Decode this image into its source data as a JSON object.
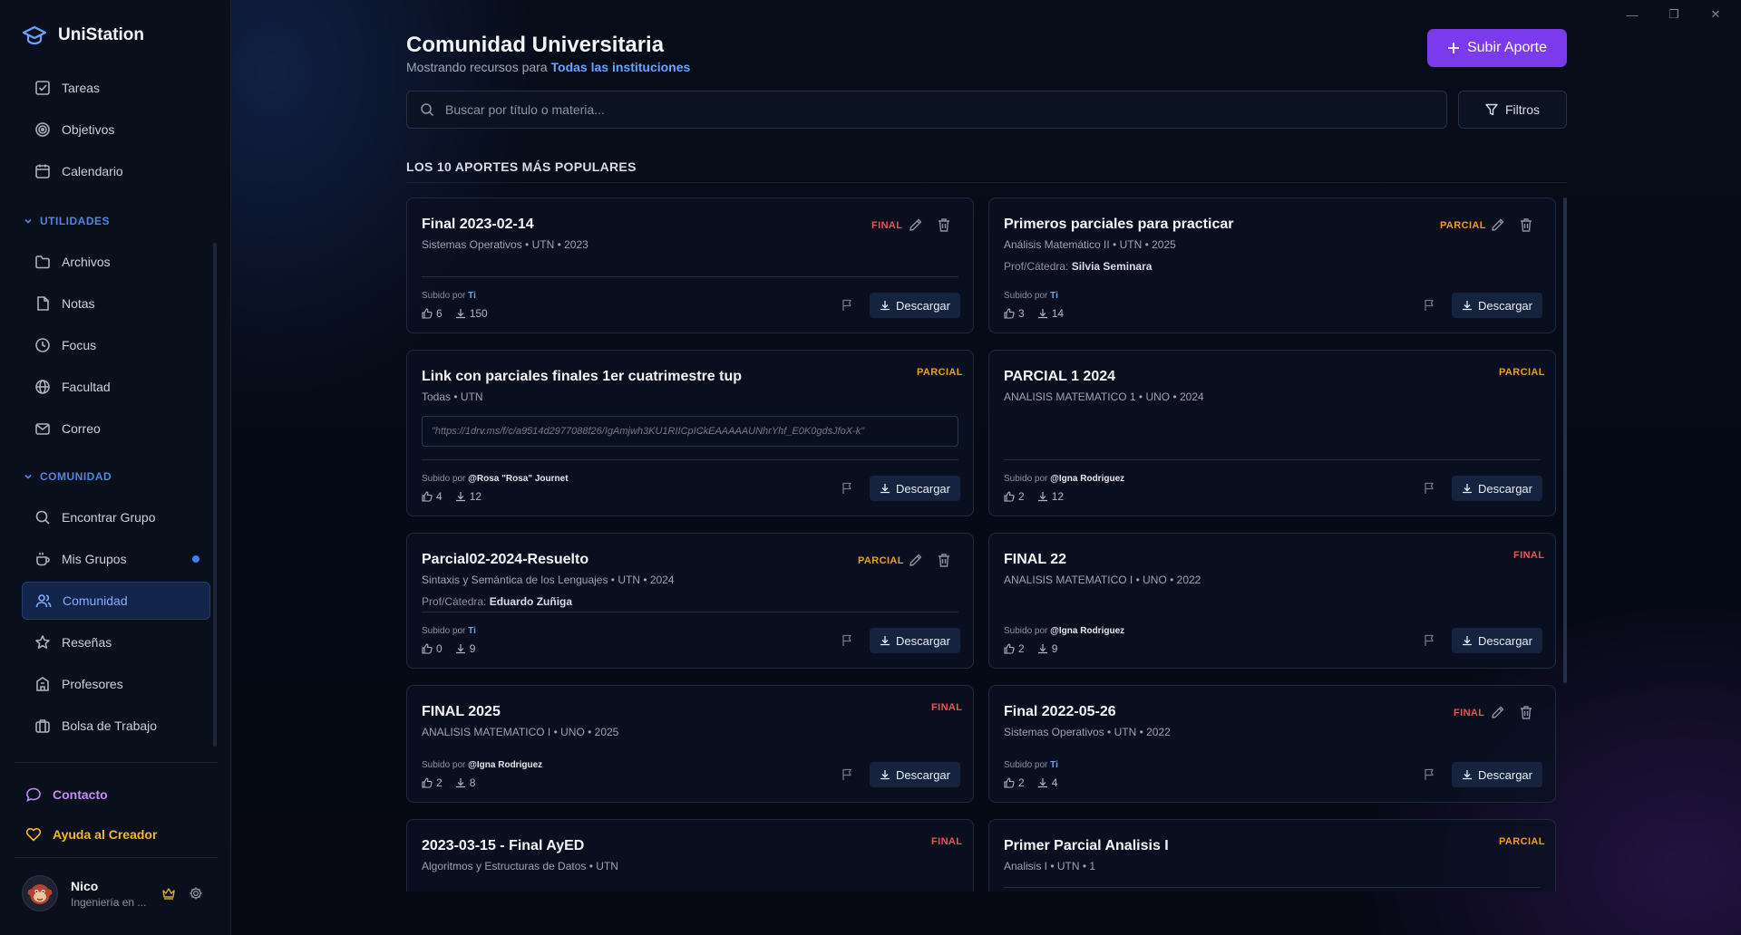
{
  "app": {
    "name": "UniStation"
  },
  "window": {
    "minimize": "—",
    "maximize": "❐",
    "close": "✕"
  },
  "sidebar": {
    "top_items": [
      {
        "label": "Tareas",
        "icon": "checkbox-icon"
      },
      {
        "label": "Objetivos",
        "icon": "target-icon"
      },
      {
        "label": "Calendario",
        "icon": "calendar-icon"
      }
    ],
    "utilidades": {
      "header": "UTILIDADES",
      "items": [
        {
          "label": "Archivos",
          "icon": "folder-icon"
        },
        {
          "label": "Notas",
          "icon": "note-icon"
        },
        {
          "label": "Focus",
          "icon": "clock-icon"
        },
        {
          "label": "Facultad",
          "icon": "globe-icon"
        },
        {
          "label": "Correo",
          "icon": "mail-icon"
        }
      ]
    },
    "comunidad": {
      "header": "COMUNIDAD",
      "items": [
        {
          "label": "Encontrar Grupo",
          "icon": "search-icon"
        },
        {
          "label": "Mis Grupos",
          "icon": "coffee-icon"
        },
        {
          "label": "Comunidad",
          "icon": "users-icon"
        },
        {
          "label": "Reseñas",
          "icon": "star-icon"
        },
        {
          "label": "Profesores",
          "icon": "building-icon"
        },
        {
          "label": "Bolsa de Trabajo",
          "icon": "briefcase-icon"
        }
      ]
    },
    "contacto": "Contacto",
    "ayuda": "Ayuda al Creador",
    "user": {
      "name": "Nico",
      "subtitle": "Ingeniería en ..."
    }
  },
  "main": {
    "title": "Comunidad Universitaria",
    "subtitle_prefix": "Mostrando recursos para",
    "subtitle_highlight": "Todas las instituciones",
    "upload_button": "Subir Aporte",
    "search_placeholder": "Buscar por título o materia...",
    "filter_button": "Filtros",
    "section_title": "LOS 10 APORTES MÁS POPULARES",
    "uploaded_by": "Subido por",
    "prof_label": "Prof/Cátedra:",
    "download": "Descargar",
    "cards": [
      {
        "title": "Final 2023-02-14",
        "meta": "Sistemas Operativos • UTN • 2023",
        "badge": "FINAL",
        "uploader": "Ti",
        "likes": "6",
        "downloads": "150"
      },
      {
        "title": "Primeros parciales para practicar",
        "meta": "Análisis Matemático II • UTN • 2025",
        "badge": "PARCIAL",
        "prof": "Silvia Seminara",
        "uploader": "Ti",
        "likes": "3",
        "downloads": "14"
      },
      {
        "title": "Link con parciales finales 1er cuatrimestre tup",
        "meta": "Todas • UTN",
        "badge": "PARCIAL",
        "link": "\"https://1drv.ms/f/c/a9514d2977088f26/IgAmjwh3KU1RIICpICkEAAAAAUNhrYhf_E0K0gdsJfoX-k\"",
        "uploader": "@Rosa \"Rosa\" Journet",
        "likes": "4",
        "downloads": "12"
      },
      {
        "title": "PARCIAL 1 2024",
        "meta": "ANALISIS MATEMATICO 1 • UNO • 2024",
        "badge": "PARCIAL",
        "uploader": "@Igna Rodriguez",
        "likes": "2",
        "downloads": "12"
      },
      {
        "title": "Parcial02-2024-Resuelto",
        "meta": "Sintaxis y Semántica de los Lenguajes • UTN • 2024",
        "badge": "PARCIAL",
        "prof": "Eduardo Zuñiga",
        "uploader": "Ti",
        "likes": "0",
        "downloads": "9"
      },
      {
        "title": "FINAL 22",
        "meta": "ANALISIS MATEMATICO I • UNO • 2022",
        "badge": "FINAL",
        "uploader": "@Igna Rodriguez",
        "likes": "2",
        "downloads": "9"
      },
      {
        "title": "FINAL 2025",
        "meta": "ANALISIS MATEMATICO I • UNO • 2025",
        "badge": "FINAL",
        "uploader": "@Igna Rodriguez",
        "likes": "2",
        "downloads": "8"
      },
      {
        "title": "Final 2022-05-26",
        "meta": "Sistemas Operativos • UTN • 2022",
        "badge": "FINAL",
        "uploader": "Ti",
        "likes": "2",
        "downloads": "4"
      },
      {
        "title": "2023-03-15 - Final AyED",
        "meta": "Algoritmos y Estructuras de Datos • UTN",
        "badge": "FINAL"
      },
      {
        "title": "Primer Parcial Analisis I",
        "meta": "Analisis I • UTN • 1",
        "badge": "PARCIAL"
      }
    ]
  }
}
